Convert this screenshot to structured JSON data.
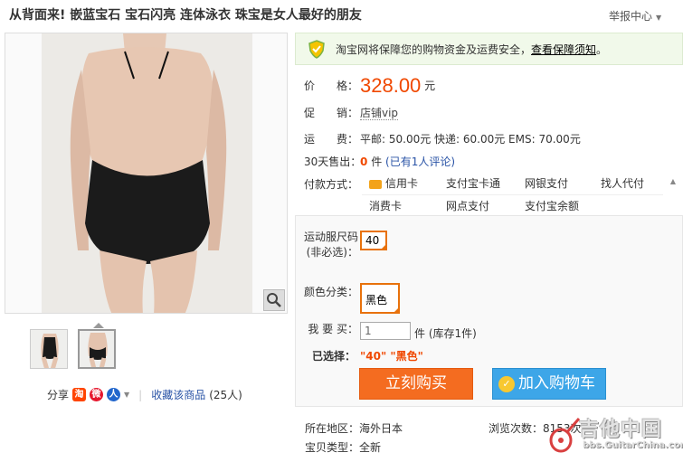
{
  "header": {
    "title": "从背面来! 嵌蓝宝石 宝石闪亮 连体泳衣 珠宝是女人最好的朋友",
    "report": "举报中心"
  },
  "gallery": {
    "zoom_icon": "magnifier-icon",
    "selected_thumb": 1
  },
  "share": {
    "label": "分享",
    "icons": [
      "taobao-icon",
      "weibo-icon",
      "renren-icon"
    ],
    "favorite": "收藏该商品",
    "favorite_count": "(25人)"
  },
  "guarantee": {
    "text": "淘宝网将保障您的购物资金及运费安全，",
    "link": "查看保障须知",
    "end": "。"
  },
  "price": {
    "label": "价　　格：",
    "value": "328.00",
    "unit": "元"
  },
  "promo": {
    "label": "促　　销：",
    "value": "店铺vip"
  },
  "shipping": {
    "label": "运　　费：",
    "value": "平邮: 50.00元 快递: 60.00元 EMS: 70.00元"
  },
  "sales": {
    "label": "30天售出：",
    "count": "0",
    "unit": "件",
    "reviews": "(已有1人评论)"
  },
  "payment": {
    "label": "付款方式：",
    "methods": [
      "信用卡",
      "支付宝卡通",
      "网银支付",
      "找人代付",
      "消费卡",
      "网点支付",
      "支付宝余额"
    ]
  },
  "options": {
    "size_label": "运动服尺码(非必选)：",
    "size_value": "40",
    "color_label": "颜色分类：",
    "color_value": "黑色",
    "qty_label": "我 要 买：",
    "qty_value": "1",
    "stock": "件 (库存1件)",
    "selected_label": "已选择：",
    "selected_value": "\"40\" \"黑色\""
  },
  "actions": {
    "buy": "立刻购买",
    "cart": "加入购物车"
  },
  "details": {
    "region_label": "所在地区：",
    "region": "海外日本",
    "views_label": "浏览次数：",
    "views": "8153次",
    "type_label": "宝贝类型：",
    "type": "全新"
  },
  "watermark": {
    "text": "吉他中国",
    "url": "bbs.GuitarChina.com"
  },
  "colors": {
    "accent": "#f04800",
    "link": "#2953a6",
    "buy": "#f46c20",
    "cart": "#3da6e8"
  }
}
